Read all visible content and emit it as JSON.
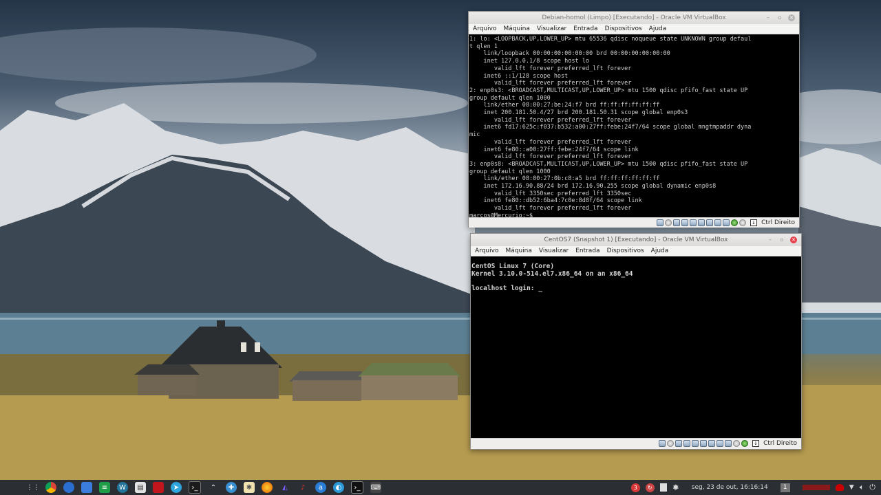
{
  "desktop": {
    "wallpaper": "snowy-mountains-house-lake"
  },
  "debian_window": {
    "title": "Debian-homol (Limpo) [Executando] - Oracle VM VirtualBox",
    "menu": [
      "Arquivo",
      "Máquina",
      "Visualizar",
      "Entrada",
      "Dispositivos",
      "Ajuda"
    ],
    "terminal_lines": [
      "1: lo: <LOOPBACK,UP,LOWER_UP> mtu 65536 qdisc noqueue state UNKNOWN group defaul",
      "t qlen 1",
      "    link/loopback 00:00:00:00:00:00 brd 00:00:00:00:00:00",
      "    inet 127.0.0.1/8 scope host lo",
      "       valid_lft forever preferred_lft forever",
      "    inet6 ::1/128 scope host",
      "       valid_lft forever preferred_lft forever",
      "2: enp0s3: <BROADCAST,MULTICAST,UP,LOWER_UP> mtu 1500 qdisc pfifo_fast state UP",
      "group default qlen 1000",
      "    link/ether 08:00:27:be:24:f7 brd ff:ff:ff:ff:ff:ff",
      "    inet 200.181.50.4/27 brd 200.181.50.31 scope global enp0s3",
      "       valid_lft forever preferred_lft forever",
      "    inet6 fd17:625c:f037:b532:a00:27ff:febe:24f7/64 scope global mngtmpaddr dyna",
      "mic",
      "       valid_lft forever preferred_lft forever",
      "    inet6 fe80::a00:27ff:febe:24f7/64 scope link",
      "       valid_lft forever preferred_lft forever",
      "3: enp0s8: <BROADCAST,MULTICAST,UP,LOWER_UP> mtu 1500 qdisc pfifo_fast state UP",
      "group default qlen 1000",
      "    link/ether 08:00:27:0b:c8:a5 brd ff:ff:ff:ff:ff:ff",
      "    inet 172.16.90.88/24 brd 172.16.90.255 scope global dynamic enp0s8",
      "       valid_lft 3350sec preferred_lft 3350sec",
      "    inet6 fe80::db52:6ba4:7c0e:8d8f/64 scope link",
      "       valid_lft forever preferred_lft forever",
      "marcos@Mercurio:~$ _"
    ],
    "host_key": "Ctrl Direito"
  },
  "centos_window": {
    "title": "CentOS7 (Snapshot 1) [Executando] - Oracle VM VirtualBox",
    "menu": [
      "Arquivo",
      "Máquina",
      "Visualizar",
      "Entrada",
      "Dispositivos",
      "Ajuda"
    ],
    "console_lines": [
      "CentOS Linux 7 (Core)",
      "Kernel 3.10.0-514.el7.x86_64 on an x86_64",
      "",
      "localhost login: _"
    ],
    "host_key": "Ctrl Direito"
  },
  "taskbar": {
    "apps": [
      "apps-grid-icon",
      "chrome-icon",
      "thunderbird-icon",
      "files-icon",
      "spreadsheet-icon",
      "wordpress-icon",
      "document-icon",
      "red-app-icon",
      "telegram-icon",
      "terminal-icon",
      "launcher-icon",
      "network-icon",
      "settings-icon",
      "firefox-icon",
      "ide-icon",
      "mpx-icon",
      "browser-icon",
      "web-icon",
      "console-icon",
      "keyboard-icon"
    ],
    "notification_count": "3",
    "clock": "seg, 23 de out, 16:16:14",
    "workspace": "1",
    "accent": "#d93939"
  }
}
